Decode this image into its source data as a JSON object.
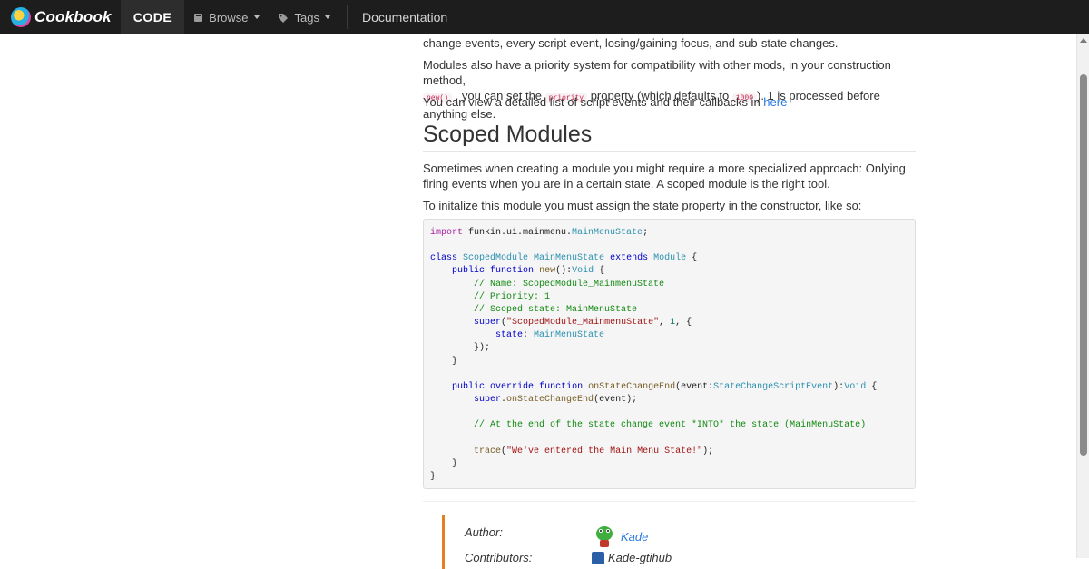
{
  "nav": {
    "brand": "Cookbook",
    "code_tab": "CODE",
    "browse": "Browse",
    "tags": "Tags",
    "documentation": "Documentation"
  },
  "content": {
    "para_cut": "change events, every script event, losing/gaining focus, and sub-state changes.",
    "para1_a": "Modules also have a priority system for compatibility with other mods, in your construction method,",
    "para1_code1": "new()",
    "para1_b": ", you can set the",
    "para1_code2": "priority",
    "para1_c": "property (which defaults to",
    "para1_code3": "1000",
    "para1_d": "). 1 is processed before anything else.",
    "para2_a": "You can view a detailed list of script events and their callbacks in",
    "para2_link": "here",
    "heading": "Scoped Modules",
    "para3": "Sometimes when creating a module you might require a more specialized approach: Onlying firing events when you are in a certain state. A scoped module is the right tool.",
    "para4": "To initalize this module you must assign the state property in the constructor, like so:"
  },
  "author": {
    "author_label": "Author:",
    "author_name": "Kade",
    "contributors_label": "Contributors:",
    "contributor_name": "Kade-gtihub"
  },
  "colors": {
    "navbar": "#1d1d1d",
    "accent_link": "#2a7ae2",
    "author_border": "#e67e22",
    "code_bg": "#f5f5f5"
  }
}
